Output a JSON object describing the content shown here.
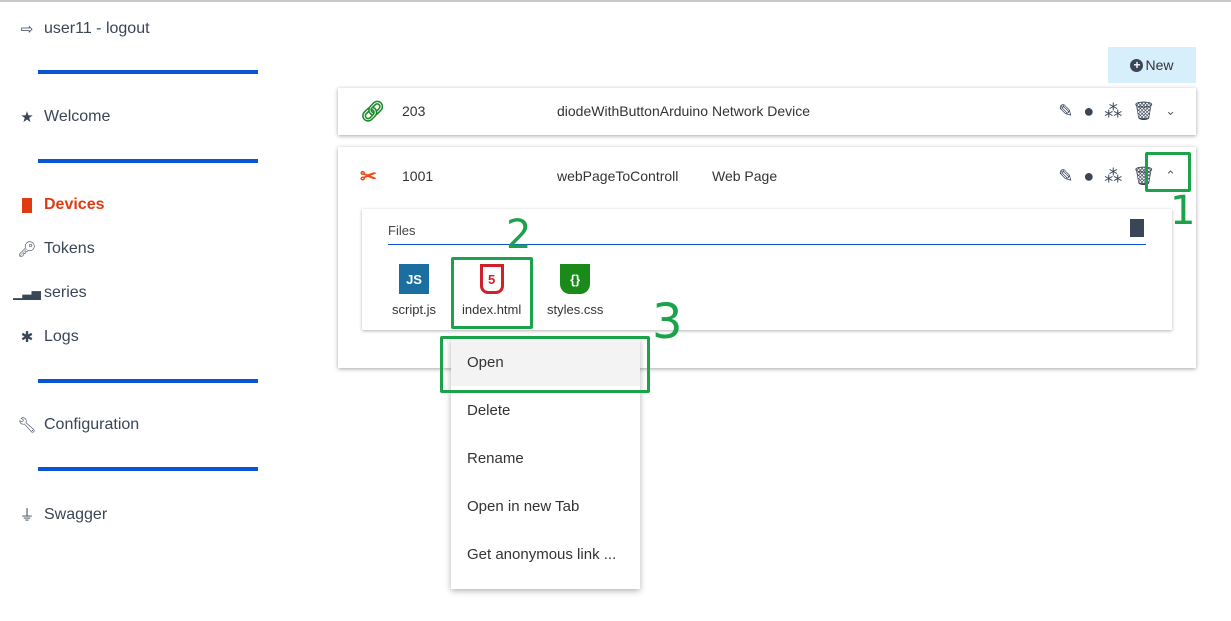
{
  "sidebar": {
    "user": "user11 - logout",
    "items": [
      {
        "label": "Welcome",
        "icon": "star-icon"
      },
      {
        "label": "Devices",
        "icon": "chip-icon",
        "active": true
      },
      {
        "label": "Tokens",
        "icon": "key-icon"
      },
      {
        "label": "series",
        "icon": "bar-chart-icon"
      },
      {
        "label": "Logs",
        "icon": "bug-icon"
      },
      {
        "label": "Configuration",
        "icon": "wrench-icon"
      },
      {
        "label": "Swagger",
        "icon": "plug-icon"
      }
    ]
  },
  "toolbar": {
    "new_label": "New"
  },
  "devices": [
    {
      "id": "203",
      "name": "diodeWithButtonArduino",
      "type": "Network Device",
      "status": "connected",
      "color": "#1a8a2a",
      "expanded": false
    },
    {
      "id": "1001",
      "name": "webPageToControll",
      "type": "Web Page",
      "status": "disconnected",
      "color": "#f04a1a",
      "expanded": true
    }
  ],
  "files": {
    "label": "Files",
    "items": [
      {
        "name": "script.js",
        "icon": "JS",
        "color": "#1b6fa0"
      },
      {
        "name": "index.html",
        "icon": "5",
        "color": "#d0202a"
      },
      {
        "name": "styles.css",
        "icon": "{}",
        "color": "#1a8a1a"
      }
    ]
  },
  "context_menu": {
    "items": [
      "Open",
      "Delete",
      "Rename",
      "Open in new Tab",
      "Get anonymous link ..."
    ],
    "highlighted": "Open"
  },
  "annotations": [
    "1",
    "2",
    "3"
  ],
  "colors": {
    "accent": "#0a55d6",
    "active": "#e03a12",
    "annotation": "#1aa34a"
  }
}
